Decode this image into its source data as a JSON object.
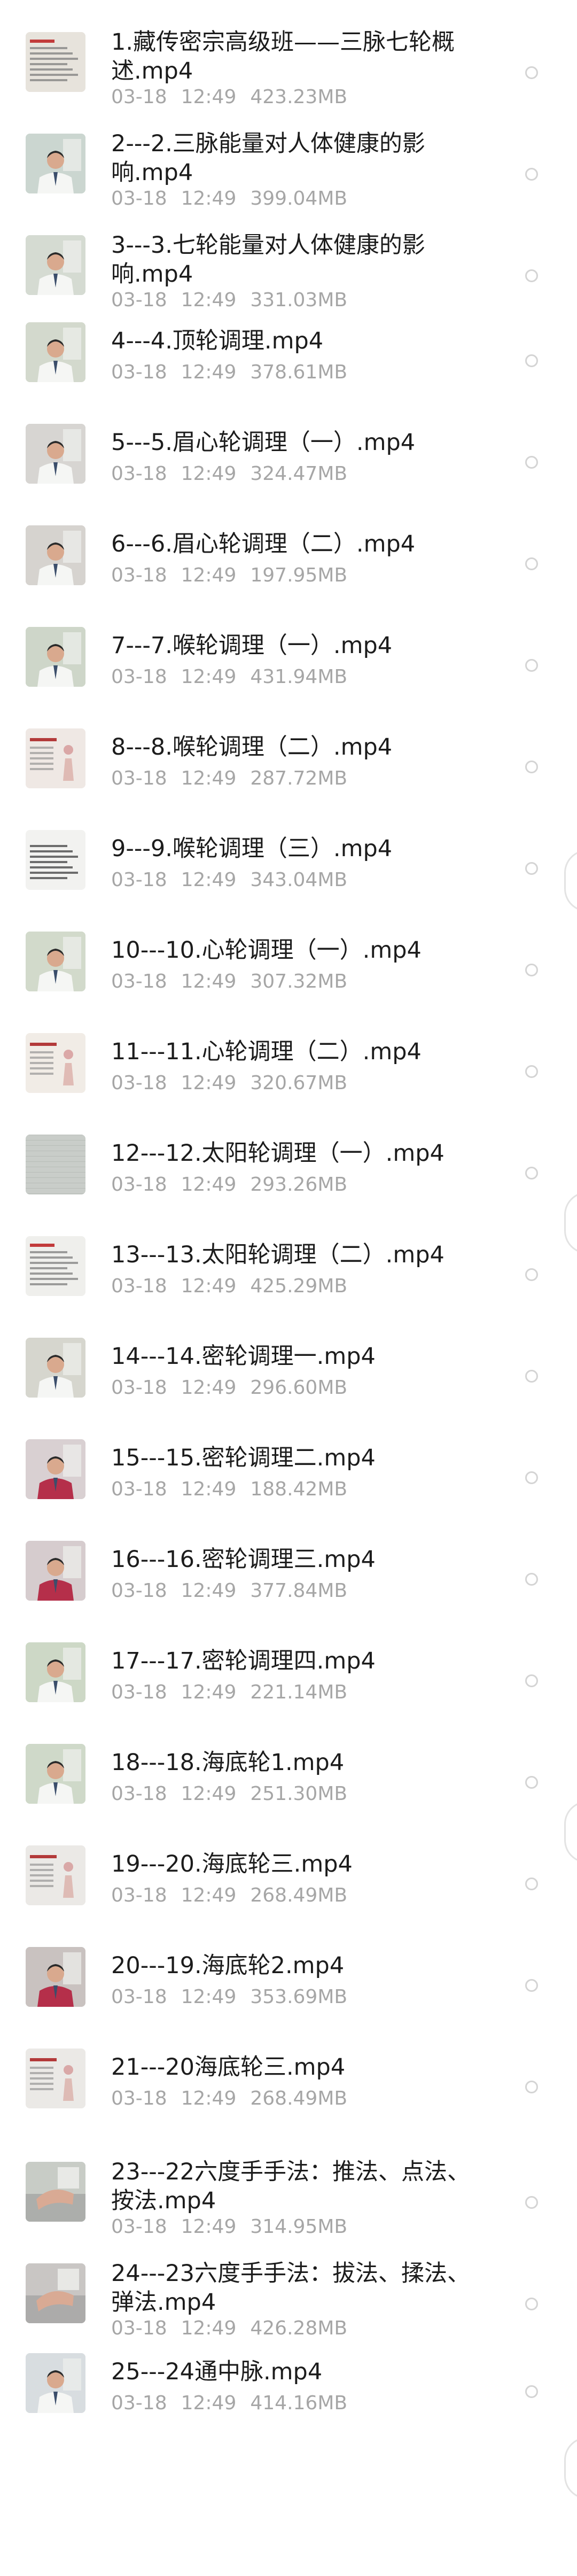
{
  "files": [
    {
      "name_lines": [
        "1.藏传密宗高级班——三脉七轮概",
        "述.mp4"
      ],
      "date": "03-18",
      "time": "12:49",
      "size": "423.23MB",
      "thumb": "slide",
      "thumb_color": "#e7e3dc"
    },
    {
      "name_lines": [
        "2---2.三脉能量对人体健康的影",
        "响.mp4"
      ],
      "date": "03-18",
      "time": "12:49",
      "size": "399.04MB",
      "thumb": "person",
      "thumb_color": "#cbd6d0"
    },
    {
      "name_lines": [
        "3---3.七轮能量对人体健康的影",
        "响.mp4"
      ],
      "date": "03-18",
      "time": "12:49",
      "size": "331.03MB",
      "thumb": "person",
      "thumb_color": "#d5dbd2"
    },
    {
      "name_lines": [
        "4---4.顶轮调理.mp4"
      ],
      "date": "03-18",
      "time": "12:49",
      "size": "378.61MB",
      "thumb": "person",
      "thumb_color": "#d3d9cd"
    },
    {
      "name_lines": [
        "5---5.眉心轮调理（一）.mp4"
      ],
      "date": "03-18",
      "time": "12:49",
      "size": "324.47MB",
      "thumb": "person",
      "thumb_color": "#d7d5d2"
    },
    {
      "name_lines": [
        "6---6.眉心轮调理（二）.mp4"
      ],
      "date": "03-18",
      "time": "12:49",
      "size": "197.95MB",
      "thumb": "person",
      "thumb_color": "#d6d3cf"
    },
    {
      "name_lines": [
        "7---7.喉轮调理（一）.mp4"
      ],
      "date": "03-18",
      "time": "12:49",
      "size": "431.94MB",
      "thumb": "person",
      "thumb_color": "#ced6c9"
    },
    {
      "name_lines": [
        "8---8.喉轮调理（二）.mp4"
      ],
      "date": "03-18",
      "time": "12:49",
      "size": "287.72MB",
      "thumb": "slide-figure",
      "thumb_color": "#efe8e4"
    },
    {
      "name_lines": [
        "9---9.喉轮调理（三）.mp4"
      ],
      "date": "03-18",
      "time": "12:49",
      "size": "343.04MB",
      "thumb": "text-slide",
      "thumb_color": "#f2f2f0"
    },
    {
      "name_lines": [
        "10---10.心轮调理（一）.mp4"
      ],
      "date": "03-18",
      "time": "12:49",
      "size": "307.32MB",
      "thumb": "person",
      "thumb_color": "#d2dacb"
    },
    {
      "name_lines": [
        "11---11.心轮调理（二）.mp4"
      ],
      "date": "03-18",
      "time": "12:49",
      "size": "320.67MB",
      "thumb": "slide-figure",
      "thumb_color": "#f1ece6"
    },
    {
      "name_lines": [
        "12---12.太阳轮调理（一）.mp4"
      ],
      "date": "03-18",
      "time": "12:49",
      "size": "293.26MB",
      "thumb": "blank",
      "thumb_color": "#c9cdc9"
    },
    {
      "name_lines": [
        "13---13.太阳轮调理（二）.mp4"
      ],
      "date": "03-18",
      "time": "12:49",
      "size": "425.29MB",
      "thumb": "slide",
      "thumb_color": "#efefec"
    },
    {
      "name_lines": [
        "14---14.密轮调理一.mp4"
      ],
      "date": "03-18",
      "time": "12:49",
      "size": "296.60MB",
      "thumb": "person",
      "thumb_color": "#d6d6ce"
    },
    {
      "name_lines": [
        "15---15.密轮调理二.mp4"
      ],
      "date": "03-18",
      "time": "12:49",
      "size": "188.42MB",
      "thumb": "person-red",
      "thumb_color": "#d9d0d2"
    },
    {
      "name_lines": [
        "16---16.密轮调理三.mp4"
      ],
      "date": "03-18",
      "time": "12:49",
      "size": "377.84MB",
      "thumb": "person-red",
      "thumb_color": "#d6ccce"
    },
    {
      "name_lines": [
        "17---17.密轮调理四.mp4"
      ],
      "date": "03-18",
      "time": "12:49",
      "size": "221.14MB",
      "thumb": "person",
      "thumb_color": "#cdd8c6"
    },
    {
      "name_lines": [
        "18---18.海底轮1.mp4"
      ],
      "date": "03-18",
      "time": "12:49",
      "size": "251.30MB",
      "thumb": "person",
      "thumb_color": "#cfd9c9"
    },
    {
      "name_lines": [
        "19---20.海底轮三.mp4"
      ],
      "date": "03-18",
      "time": "12:49",
      "size": "268.49MB",
      "thumb": "slide-figure",
      "thumb_color": "#ebe9e6"
    },
    {
      "name_lines": [
        "20---19.海底轮2.mp4"
      ],
      "date": "03-18",
      "time": "12:49",
      "size": "353.69MB",
      "thumb": "person-red",
      "thumb_color": "#c9c2c0"
    },
    {
      "name_lines": [
        "21---20海底轮三.mp4"
      ],
      "date": "03-18",
      "time": "12:49",
      "size": "268.49MB",
      "thumb": "slide-figure",
      "thumb_color": "#ebe9e6"
    },
    {
      "name_lines": [
        "23---22六度手手法：推法、点法、",
        "按法.mp4"
      ],
      "date": "03-18",
      "time": "12:49",
      "size": "314.95MB",
      "thumb": "hands",
      "thumb_color": "#c8ccc6"
    },
    {
      "name_lines": [
        "24---23六度手手法：拔法、揉法、",
        "弹法.mp4"
      ],
      "date": "03-18",
      "time": "12:49",
      "size": "426.28MB",
      "thumb": "hands",
      "thumb_color": "#c9c6c4"
    },
    {
      "name_lines": [
        "25---24通中脉.mp4"
      ],
      "date": "03-18",
      "time": "12:49",
      "size": "414.16MB",
      "thumb": "person",
      "thumb_color": "#d8dde0"
    }
  ]
}
